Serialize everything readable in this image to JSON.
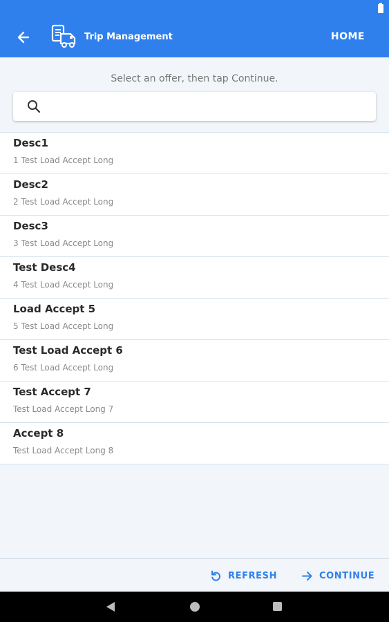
{
  "app_bar": {
    "title": "Trip Management",
    "home_label": "HOME",
    "color": "#2f80ec"
  },
  "instruction": "Select an offer, then tap Continue.",
  "search": {
    "value": "",
    "placeholder": ""
  },
  "offers": [
    {
      "title": "Desc1",
      "subtitle": "1 Test Load Accept Long"
    },
    {
      "title": "Desc2",
      "subtitle": "2 Test Load Accept Long"
    },
    {
      "title": "Desc3",
      "subtitle": "3 Test Load Accept Long"
    },
    {
      "title": "Test Desc4",
      "subtitle": "4 Test Load Accept Long"
    },
    {
      "title": "Load Accept 5",
      "subtitle": "5 Test Load Accept Long"
    },
    {
      "title": "Test Load Accept 6",
      "subtitle": "6 Test Load Accept Long"
    },
    {
      "title": "Test Accept 7",
      "subtitle": "Test Load Accept Long 7"
    },
    {
      "title": "Accept 8",
      "subtitle": "Test Load Accept Long 8"
    }
  ],
  "actions": {
    "refresh_label": "REFRESH",
    "continue_label": "CONTINUE"
  },
  "icons": {
    "back": "arrow-left-icon",
    "logo": "truck-document-icon",
    "search": "search-icon",
    "refresh": "refresh-icon",
    "continue": "arrow-right-icon"
  }
}
